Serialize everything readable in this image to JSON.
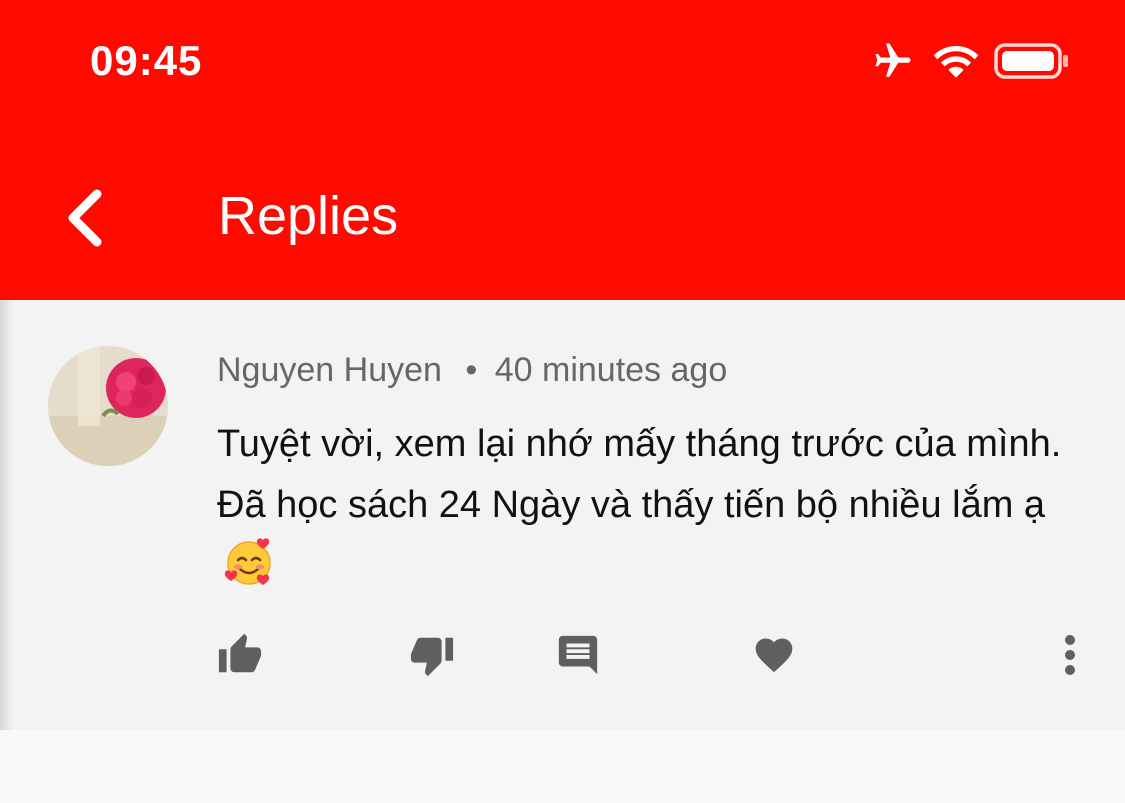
{
  "status_bar": {
    "time": "09:45",
    "icons": [
      "airplane-icon",
      "wifi-icon",
      "battery-icon"
    ]
  },
  "header": {
    "title": "Replies",
    "back_icon": "chevron-left-icon",
    "background_color": "#ff0a00"
  },
  "comment": {
    "author": "Nguyen Huyen",
    "separator": "•",
    "time_ago": "40 minutes ago",
    "text": "Tuyệt vời, xem lại nhớ mấy tháng trước của mình. Đã học sách 24 Ngày và thấy tiến bộ nhiều lắm ạ",
    "emoji": "smiling-face-with-hearts",
    "actions": [
      "thumbs-up-icon",
      "thumbs-down-icon",
      "reply-comment-icon",
      "heart-icon",
      "more-vertical-icon"
    ]
  }
}
